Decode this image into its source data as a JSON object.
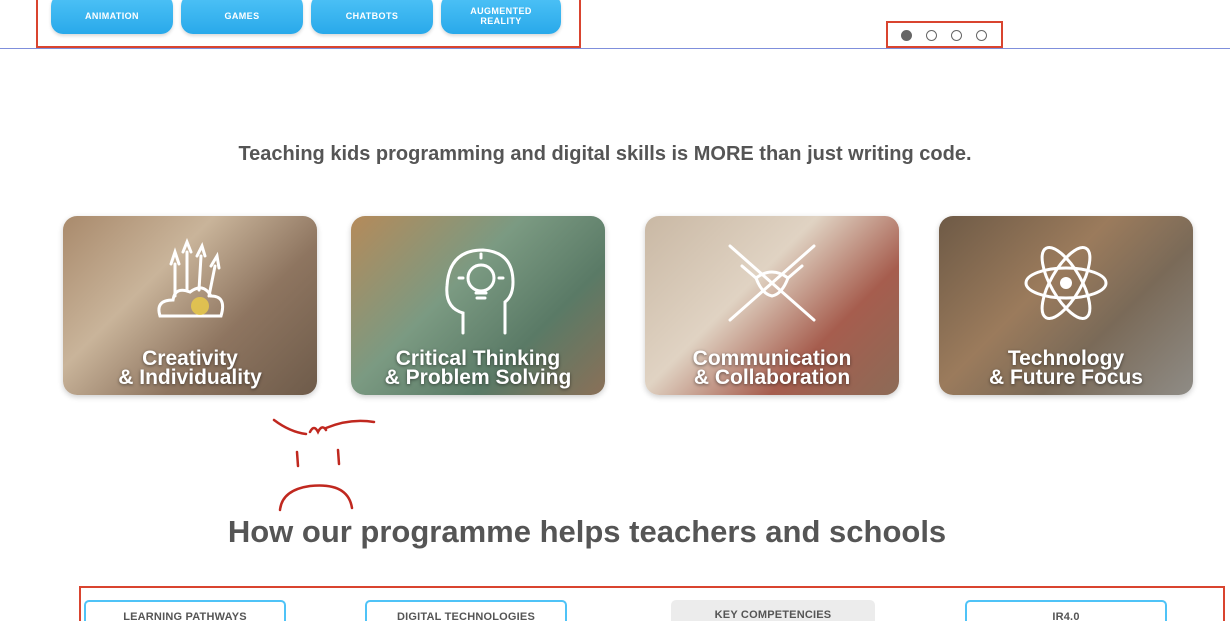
{
  "categories": [
    "ANIMATION",
    "GAMES",
    "CHATBOTS",
    "AUGMENTED REALITY"
  ],
  "carousel": {
    "total": 4,
    "active": 1
  },
  "tagline": "Teaching kids programming and digital skills is MORE than just writing code.",
  "skills": [
    {
      "line1": "Creativity",
      "line2": "& Individuality",
      "icon": "paint-brushes-icon"
    },
    {
      "line1": "Critical Thinking",
      "line2": "& Problem Solving",
      "icon": "lightbulb-head-icon"
    },
    {
      "line1": "Communication",
      "line2": "& Collaboration",
      "icon": "hands-together-icon"
    },
    {
      "line1": "Technology",
      "line2": "& Future Focus",
      "icon": "atom-icon"
    }
  ],
  "section_heading": "How our programme helps teachers and schools",
  "tabs": [
    "LEARNING PATHWAYS",
    "DIGITAL TECHNOLOGIES",
    "KEY COMPETENCIES",
    "IR4.0"
  ],
  "colors": {
    "accent": "#4fc3f7",
    "highlight": "#d9442f",
    "annotation": "#c0281f"
  }
}
